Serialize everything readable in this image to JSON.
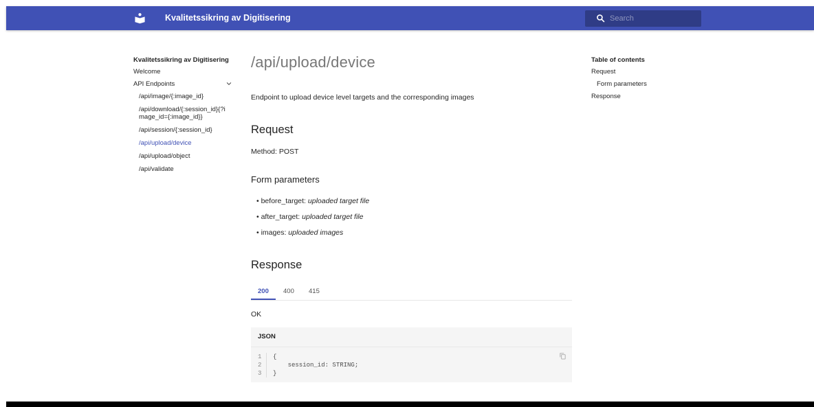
{
  "header": {
    "site_title": "Kvalitetssikring av Digitisering",
    "search_placeholder": "Search",
    "primary_color": "#4051b5"
  },
  "nav": {
    "title": "Kvalitetssikring av Digitisering",
    "welcome": "Welcome",
    "section_label": "API Endpoints",
    "items": [
      {
        "label": "/api/image/{:image_id}"
      },
      {
        "label": "/api/download/{:session_id}{?image_id={:image_id}}"
      },
      {
        "label": "/api/session/{:session_id}"
      },
      {
        "label": "/api/upload/device",
        "active": true
      },
      {
        "label": "/api/upload/object"
      },
      {
        "label": "/api/validate"
      }
    ]
  },
  "main": {
    "title": "/api/upload/device",
    "intro": "Endpoint to upload device level targets and the corresponding images",
    "request_heading": "Request",
    "method_text": "Method: POST",
    "form_heading": "Form parameters",
    "params": [
      {
        "name": "before_target:",
        "desc": "uploaded target file"
      },
      {
        "name": "after_target:",
        "desc": "uploaded target file"
      },
      {
        "name": "images:",
        "desc": "uploaded images"
      }
    ],
    "response_heading": "Response",
    "tabs": [
      "200",
      "400",
      "415"
    ],
    "active_tab": "200",
    "status_text": "OK",
    "code_label": "JSON",
    "code_line_numbers": "1\n2\n3",
    "code": "{\n    session_id: STRING;\n}"
  },
  "toc": {
    "title": "Table of contents",
    "items": [
      "Request",
      "Form parameters",
      "Response"
    ]
  }
}
